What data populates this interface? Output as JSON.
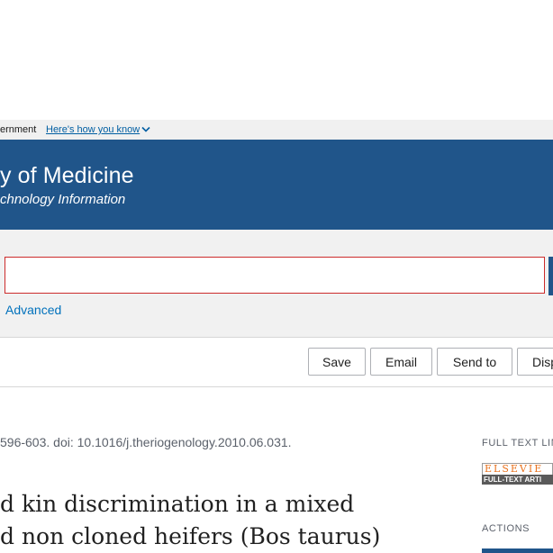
{
  "gov_banner": {
    "text": "ernment",
    "link_label": "Here's how you know",
    "chevron_icon": "chevron-down-icon"
  },
  "header": {
    "title": "y of Medicine",
    "subtitle": "chnology Information"
  },
  "search": {
    "value": "",
    "advanced_label": "Advanced"
  },
  "actions": {
    "save_label": "Save",
    "email_label": "Email",
    "send_label": "Send to",
    "display_label": "Disp"
  },
  "article": {
    "citation": "596-603. doi: 10.1016/j.theriogenology.2010.06.031.",
    "title_line1": "d kin discrimination in a mixed",
    "title_line2": "d non cloned heifers (Bos taurus)"
  },
  "sidebar": {
    "full_text_heading": "FULL TEXT LIN",
    "publisher_logo_top": "ELSEVIE",
    "publisher_logo_bottom": "FULL-TEXT ARTI",
    "actions_heading": "ACTIONS"
  },
  "colors": {
    "brand_blue": "#20558a",
    "link_blue": "#0071bc",
    "error_red": "#cc2b2b",
    "elsevier_orange": "#e9711c"
  }
}
